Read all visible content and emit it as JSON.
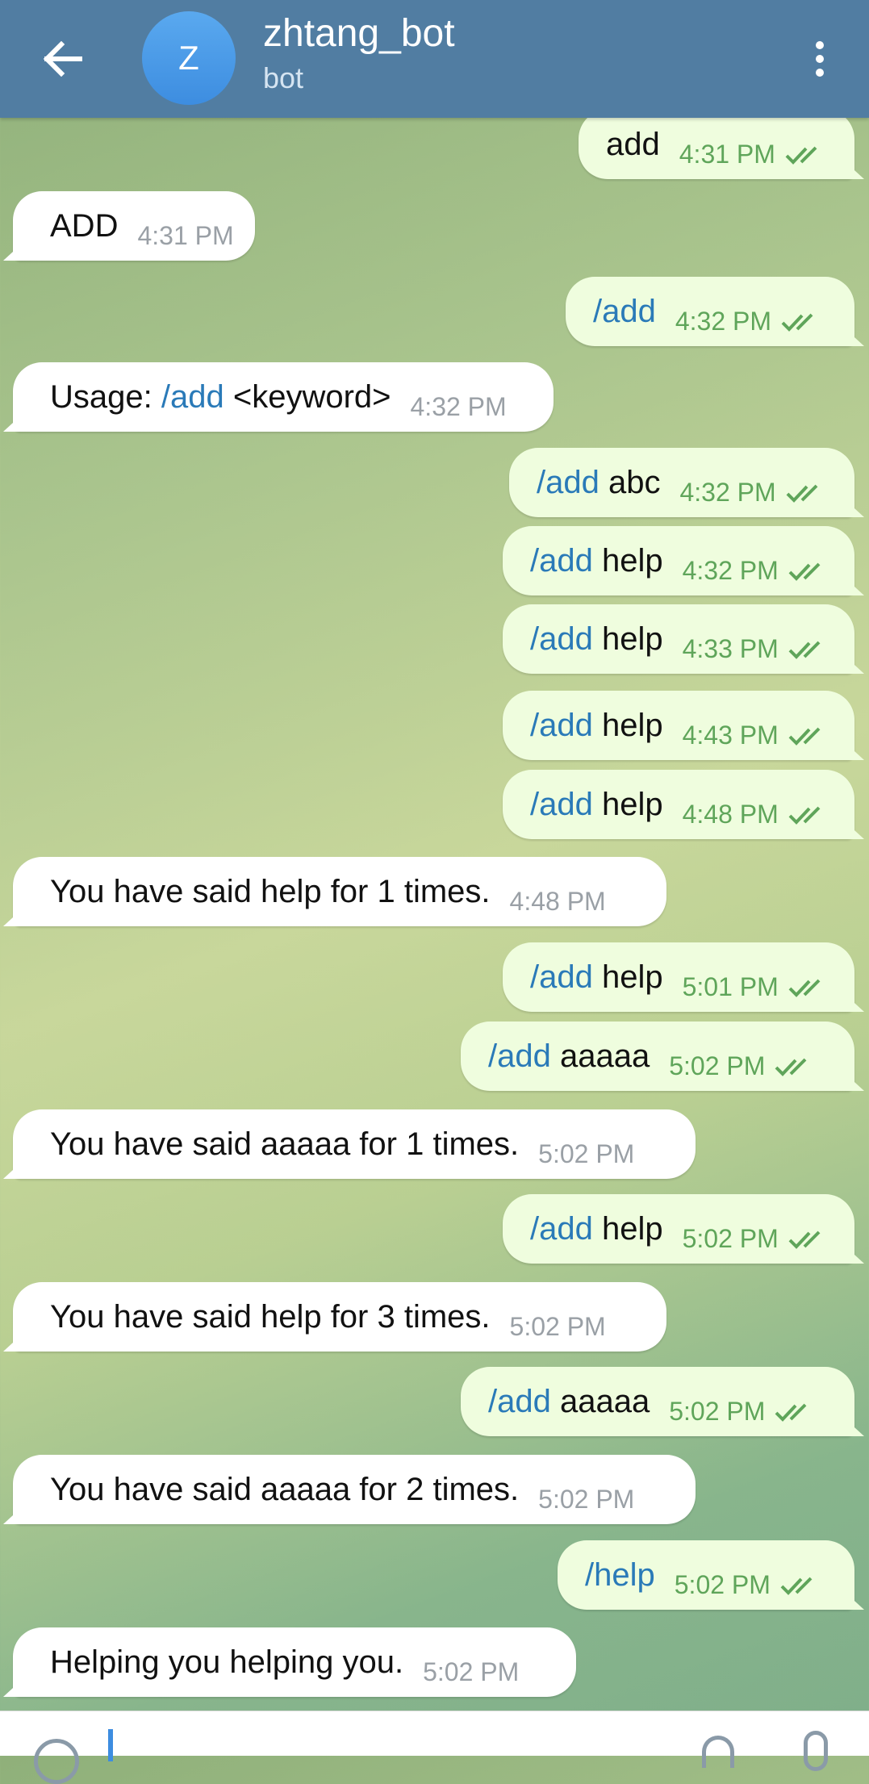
{
  "header": {
    "avatar_letter": "Z",
    "title": "zhtang_bot",
    "subtitle": "bot"
  },
  "messages": [
    {
      "dir": "out",
      "cmd": "",
      "text": "add",
      "time": "4:31 PM",
      "read": true
    },
    {
      "dir": "in",
      "cmd": "",
      "text": "ADD",
      "time": "4:31 PM"
    },
    {
      "dir": "out",
      "cmd": "/add",
      "text": "",
      "time": "4:32 PM",
      "read": true
    },
    {
      "dir": "in",
      "prefix": "Usage: ",
      "cmd": "/add",
      "text": " <keyword>",
      "time": "4:32 PM"
    },
    {
      "dir": "out",
      "cmd": "/add",
      "text": " abc",
      "time": "4:32 PM",
      "read": true
    },
    {
      "dir": "out",
      "cmd": "/add",
      "text": " help",
      "time": "4:32 PM",
      "read": true
    },
    {
      "dir": "out",
      "cmd": "/add",
      "text": " help",
      "time": "4:33 PM",
      "read": true
    },
    {
      "dir": "out",
      "cmd": "/add",
      "text": " help",
      "time": "4:43 PM",
      "read": true
    },
    {
      "dir": "out",
      "cmd": "/add",
      "text": " help",
      "time": "4:48 PM",
      "read": true
    },
    {
      "dir": "in",
      "cmd": "",
      "text": "You have said help for 1 times.",
      "time": "4:48 PM"
    },
    {
      "dir": "out",
      "cmd": "/add",
      "text": " help",
      "time": "5:01 PM",
      "read": true
    },
    {
      "dir": "out",
      "cmd": "/add",
      "text": " aaaaa",
      "time": "5:02 PM",
      "read": true
    },
    {
      "dir": "in",
      "cmd": "",
      "text": "You have said aaaaa for 1 times.",
      "time": "5:02 PM"
    },
    {
      "dir": "out",
      "cmd": "/add",
      "text": " help",
      "time": "5:02 PM",
      "read": true
    },
    {
      "dir": "in",
      "cmd": "",
      "text": "You have said help for 3 times.",
      "time": "5:02 PM"
    },
    {
      "dir": "out",
      "cmd": "/add",
      "text": " aaaaa",
      "time": "5:02 PM",
      "read": true
    },
    {
      "dir": "in",
      "cmd": "",
      "text": "You have said aaaaa for 2 times.",
      "time": "5:02 PM"
    },
    {
      "dir": "out",
      "cmd": "/help",
      "text": "",
      "time": "5:02 PM",
      "read": true
    },
    {
      "dir": "in",
      "cmd": "",
      "text": "Helping you helping you.",
      "time": "5:02 PM"
    }
  ],
  "input": {
    "placeholder": ""
  },
  "colors": {
    "header": "#517da2",
    "command_link": "#2a7ab8",
    "outgoing_bubble": "#effdde",
    "incoming_bubble": "#ffffff",
    "read_check": "#5fa55a"
  }
}
